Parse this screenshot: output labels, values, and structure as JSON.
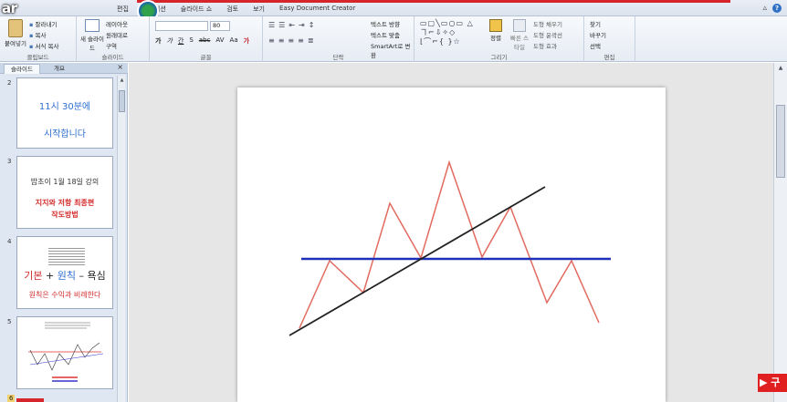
{
  "menubar": {
    "logo_text": "ar",
    "menu_items": [
      "편집",
      "이션",
      "슬라이드 쇼",
      "검토",
      "보기",
      "Easy Document Creator"
    ],
    "minimize": "▵",
    "help": "?"
  },
  "ribbon": {
    "clipboard": {
      "paste": "붙여넣기",
      "items": [
        "잘라내기",
        "복사",
        "서식 복사"
      ],
      "label": "클립보드"
    },
    "slides": {
      "new_slide": "새 슬라이드",
      "items": [
        "레이아웃",
        "원래대로",
        "구역"
      ],
      "label": "슬라이드"
    },
    "font": {
      "size": "80",
      "row2": [
        "가",
        "가",
        "간",
        "S",
        "abc",
        "AV",
        "Aa",
        "가"
      ],
      "label": "글꼴"
    },
    "paragraph": {
      "row1": [
        "☰",
        "☰",
        "⇤",
        "⇥",
        "↕"
      ],
      "row2": [
        "≡",
        "≡",
        "≡",
        "≡",
        "≣"
      ],
      "items": [
        "텍스트 방향",
        "텍스트 맞춤",
        "SmartArt로 변환"
      ],
      "label": "단락"
    },
    "drawing": {
      "shapes": "▭▢╲▭○▭ △ヿ⌐⇩✧◇ ⌊⌒⌐{ }☆",
      "arrange": "정렬",
      "quick_styles": "빠른 스타일",
      "items": [
        "도형 채우기",
        "도형 윤곽선",
        "도형 효과"
      ],
      "label": "그리기"
    },
    "editing": {
      "items": [
        "찾기",
        "바꾸기",
        "선택"
      ],
      "label": "편집"
    }
  },
  "panel": {
    "tabs": [
      "슬라이드",
      "개요"
    ],
    "close": "×",
    "slides": [
      {
        "num": "2",
        "lines": [
          "11시 30분에",
          "시작합니다"
        ]
      },
      {
        "num": "3",
        "lines": [
          "밥초이 1월 18일 강의",
          "지지와 저항 최종편",
          "작도방법"
        ]
      },
      {
        "num": "4",
        "title_parts": [
          "기본",
          " + ",
          "원칙",
          " – 욕심"
        ],
        "subtitle": "원칙은 수익과 비례한다"
      },
      {
        "num": "5"
      },
      {
        "num": "6"
      }
    ]
  },
  "overlay": {
    "yt_label": "▶ 구"
  },
  "colors": {
    "red_line": "#e26b5f",
    "blue_line": "#1e2fb8",
    "trend_line": "#222222"
  }
}
